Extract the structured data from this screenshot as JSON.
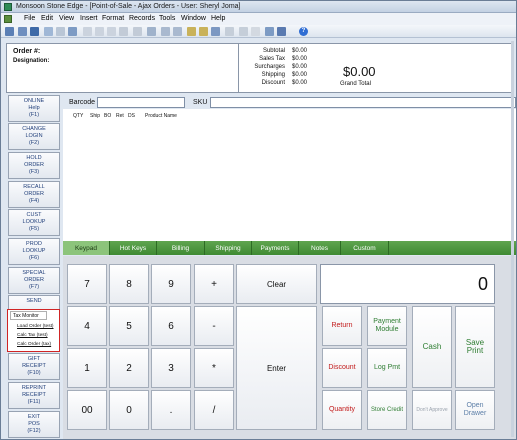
{
  "window": {
    "title": "Monsoon Stone Edge - [Point-of-Sale - Ajax Orders - User: Sheryl Joma]"
  },
  "menu": [
    {
      "label": "File",
      "key": "file"
    },
    {
      "label": "Edit",
      "key": "edit"
    },
    {
      "label": "View",
      "key": "view"
    },
    {
      "label": "Insert",
      "key": "insert"
    },
    {
      "label": "Format",
      "key": "format"
    },
    {
      "label": "Records",
      "key": "records"
    },
    {
      "label": "Tools",
      "key": "tools"
    },
    {
      "label": "Window",
      "key": "window"
    },
    {
      "label": "Help",
      "key": "help"
    }
  ],
  "order": {
    "order_label": "Order #:",
    "designation_label": "Designation:"
  },
  "totals": {
    "subtotal_label": "Subtotal",
    "subtotal_value": "$0.00",
    "sales_tax_label": "Sales Tax",
    "sales_tax_value": "$0.00",
    "surcharges_label": "Surcharges",
    "surcharges_value": "$0.00",
    "shipping_label": "Shipping",
    "shipping_value": "$0.00",
    "discount_label": "Discount",
    "discount_value": "$0.00",
    "grand_total_value": "$0.00",
    "grand_total_label": "Grand Total"
  },
  "function_buttons": [
    {
      "line1": "ONLINE",
      "line2": "Help",
      "line3": "(F1)"
    },
    {
      "line1": "CHANGE",
      "line2": "LOGIN",
      "line3": "(F2)"
    },
    {
      "line1": "HOLD",
      "line2": "ORDER",
      "line3": "(F3)"
    },
    {
      "line1": "RECALL",
      "line2": "ORDER",
      "line3": "(F4)"
    },
    {
      "line1": "CUST",
      "line2": "LOOKUP",
      "line3": "(F5)"
    },
    {
      "line1": "PROD",
      "line2": "LOOKUP",
      "line3": "(F6)"
    },
    {
      "line1": "SPECIAL",
      "line2": "ORDER",
      "line3": "(F7)"
    },
    {
      "line1": "SEND",
      "line2": "",
      "line3": ""
    },
    {
      "line1": "GIFT",
      "line2": "RECEIPT",
      "line3": "(F10)"
    },
    {
      "line1": "REPRINT",
      "line2": "RECEIPT",
      "line3": "(F11)"
    },
    {
      "line1": "EXIT",
      "line2": "POS",
      "line3": "(F12)"
    }
  ],
  "tax_monitor": {
    "title": "Tax Monitor",
    "links": [
      "Load Order (test)",
      "Calc Tax (test)",
      "Calc Order (tax)"
    ]
  },
  "entry": {
    "barcode_label": "Barcode",
    "sku_label": "SKU",
    "barcode_value": "",
    "sku_value": ""
  },
  "item_columns": [
    "QTY",
    "Ship",
    "BO",
    "Ret",
    "DS",
    "Product Name"
  ],
  "tabs": [
    "Keypad",
    "Hot Keys",
    "Billing",
    "Shipping",
    "Payments",
    "Notes",
    "Custom"
  ],
  "keypad": {
    "keys": [
      "7",
      "8",
      "9",
      "+",
      "4",
      "5",
      "6",
      "-",
      "1",
      "2",
      "3",
      "*",
      "00",
      "0",
      ".",
      "/"
    ],
    "clear_label": "Clear",
    "enter_label": "Enter",
    "display_value": "0"
  },
  "actions": {
    "return_label": "Return",
    "payment_module_line1": "Payment",
    "payment_module_line2": "Module",
    "cash_label": "Cash",
    "save_print_line1": "Save",
    "save_print_line2": "Print",
    "discount_label": "Discount",
    "log_pmt_label": "Log Pmt",
    "quantity_label": "Quantity",
    "store_credit_label": "Store Credit",
    "dont_approve_label": "Don't Approve",
    "open_drawer_line1": "Open",
    "open_drawer_line2": "Drawer"
  },
  "colors": {
    "tab_green": "#3f8a33",
    "active_tab": "#8cc47b",
    "action_red": "#c21b1b",
    "action_green": "#2e7d32",
    "popup_border": "#d02525"
  }
}
